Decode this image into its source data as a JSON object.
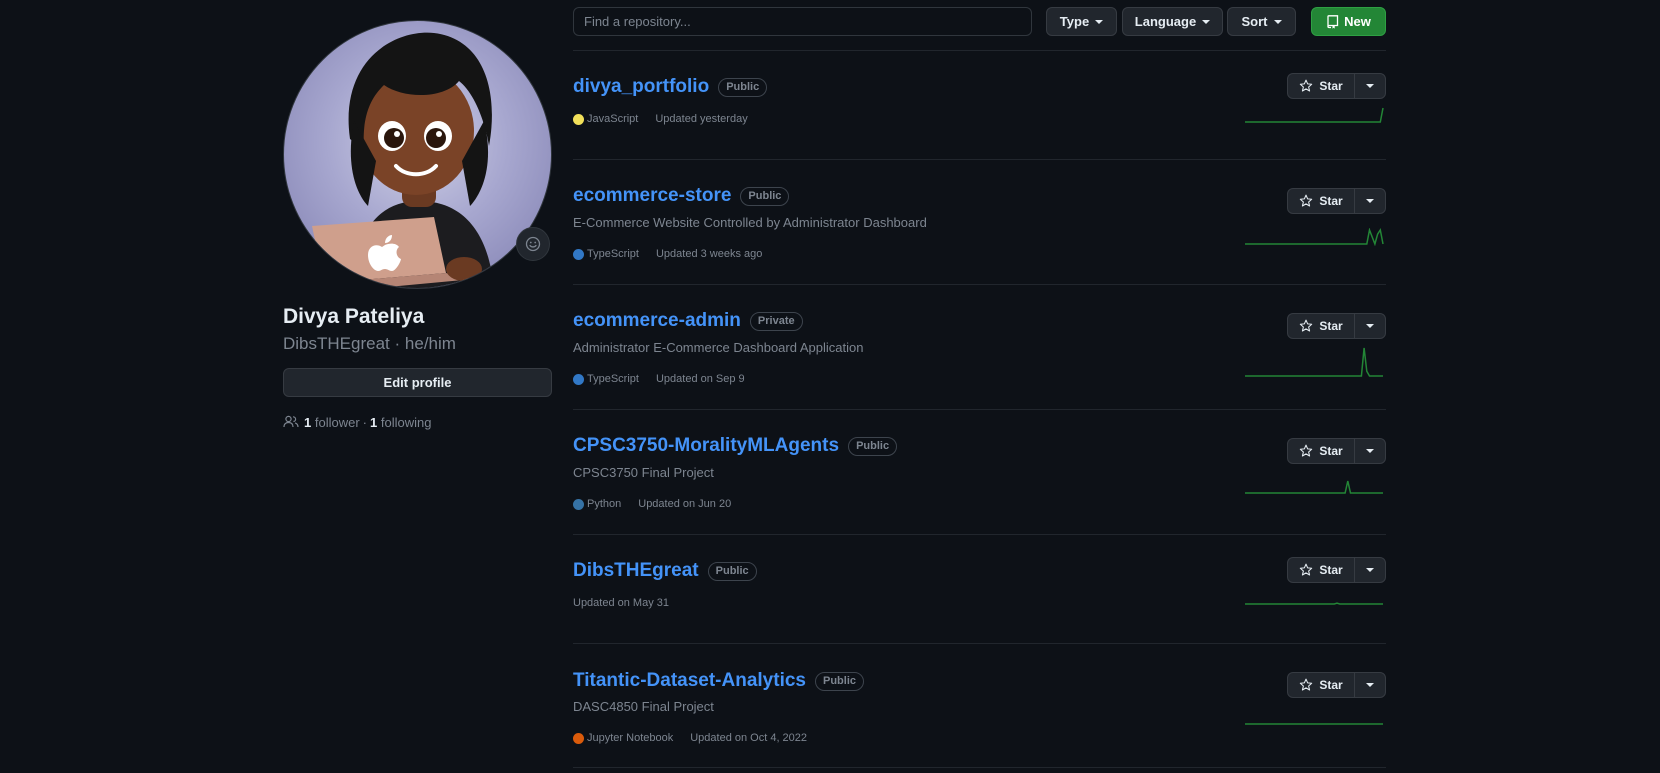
{
  "profile": {
    "name": "Divya Pateliya",
    "login": "DibsTHEgreat",
    "separator": "·",
    "pronouns": "he/him",
    "edit_label": "Edit profile",
    "followers_count": "1",
    "followers_label": "follower",
    "dot": "·",
    "following_count": "1",
    "following_label": "following"
  },
  "filters": {
    "search_placeholder": "Find a repository...",
    "type_label": "Type",
    "language_label": "Language",
    "sort_label": "Sort",
    "new_label": "New"
  },
  "colors": {
    "link": "#4493f8",
    "new_button": "#238636",
    "sparkline": "#238636"
  },
  "repos": [
    {
      "name": "divya_portfolio",
      "visibility": "Public",
      "description": "",
      "language": "JavaScript",
      "language_color": "#f1e05a",
      "updated": "Updated yesterday",
      "star_label": "Star",
      "activity": [
        0,
        0,
        0,
        0,
        0,
        0,
        0,
        0,
        0,
        0,
        0,
        0,
        0,
        0,
        0,
        0,
        0,
        0,
        0,
        0,
        0,
        0,
        0,
        0,
        0,
        0,
        0,
        0,
        0,
        0,
        0,
        0,
        0,
        0,
        0,
        0,
        0,
        0,
        0,
        0,
        0,
        0,
        0,
        0,
        0,
        0,
        0,
        0,
        0,
        0,
        0,
        1
      ]
    },
    {
      "name": "ecommerce-store",
      "visibility": "Public",
      "description": "E-Commerce Website Controlled by Administrator Dashboard",
      "language": "TypeScript",
      "language_color": "#3178c6",
      "updated": "Updated 3 weeks ago",
      "star_label": "Star",
      "activity": [
        0,
        0,
        0,
        0,
        0,
        0,
        0,
        0,
        0,
        0,
        0,
        0,
        0,
        0,
        0,
        0,
        0,
        0,
        0,
        0,
        0,
        0,
        0,
        0,
        0,
        0,
        0,
        0,
        0,
        0,
        0,
        0,
        0,
        0,
        0,
        0,
        0,
        0,
        0,
        0,
        0,
        0,
        0,
        0,
        0,
        0,
        1,
        0.5,
        0,
        0.7,
        1,
        0
      ]
    },
    {
      "name": "ecommerce-admin",
      "visibility": "Private",
      "description": "Administrator E-Commerce Dashboard Application",
      "language": "TypeScript",
      "language_color": "#3178c6",
      "updated": "Updated on Sep 9",
      "star_label": "Star",
      "activity": [
        0,
        0,
        0,
        0,
        0,
        0,
        0,
        0,
        0,
        0,
        0,
        0,
        0,
        0,
        0,
        0,
        0,
        0,
        0,
        0,
        0,
        0,
        0,
        0,
        0,
        0,
        0,
        0,
        0,
        0,
        0,
        0,
        0,
        0,
        0,
        0,
        0,
        0,
        0,
        0,
        0,
        0,
        0,
        0,
        3,
        0.5,
        0,
        0,
        0,
        0,
        0,
        0
      ]
    },
    {
      "name": "CPSC3750-MoralityMLAgents",
      "visibility": "Public",
      "description": "CPSC3750 Final Project",
      "language": "Python",
      "language_color": "#3572A5",
      "updated": "Updated on Jun 20",
      "star_label": "Star",
      "activity": [
        0,
        0,
        0,
        0,
        0,
        0,
        0,
        0,
        0,
        0,
        0,
        0,
        0,
        0,
        0,
        0,
        0,
        0,
        0,
        0,
        0,
        0,
        0,
        0,
        0,
        0,
        0,
        0,
        0,
        0,
        0,
        0,
        0,
        0,
        0,
        0,
        0,
        0,
        1,
        0,
        0,
        0,
        0,
        0,
        0,
        0,
        0,
        0,
        0,
        0,
        0,
        0
      ]
    },
    {
      "name": "DibsTHEgreat",
      "visibility": "Public",
      "description": "",
      "language": "",
      "language_color": "",
      "updated": "Updated on May 31",
      "star_label": "Star",
      "activity": [
        0,
        0,
        0,
        0,
        0,
        0,
        0,
        0,
        0,
        0,
        0,
        0,
        0,
        0,
        0,
        0,
        0,
        0,
        0,
        0,
        0,
        0,
        0,
        0,
        0,
        0,
        0,
        0,
        0,
        0,
        0,
        0,
        0,
        0,
        0.1,
        0,
        0,
        0,
        0,
        0,
        0,
        0,
        0,
        0,
        0,
        0,
        0,
        0,
        0,
        0,
        0,
        0
      ]
    },
    {
      "name": "Titantic-Dataset-Analytics",
      "visibility": "Public",
      "description": "DASC4850 Final Project",
      "language": "Jupyter Notebook",
      "language_color": "#DA5B0B",
      "updated": "Updated on Oct 4, 2022",
      "star_label": "Star",
      "activity": [
        0,
        0,
        0,
        0,
        0,
        0,
        0,
        0,
        0,
        0,
        0,
        0,
        0,
        0,
        0,
        0,
        0,
        0,
        0,
        0,
        0,
        0,
        0,
        0,
        0,
        0,
        0,
        0,
        0,
        0,
        0,
        0,
        0,
        0,
        0,
        0,
        0,
        0,
        0,
        0,
        0,
        0,
        0,
        0,
        0,
        0,
        0,
        0,
        0,
        0,
        0,
        0
      ]
    }
  ]
}
